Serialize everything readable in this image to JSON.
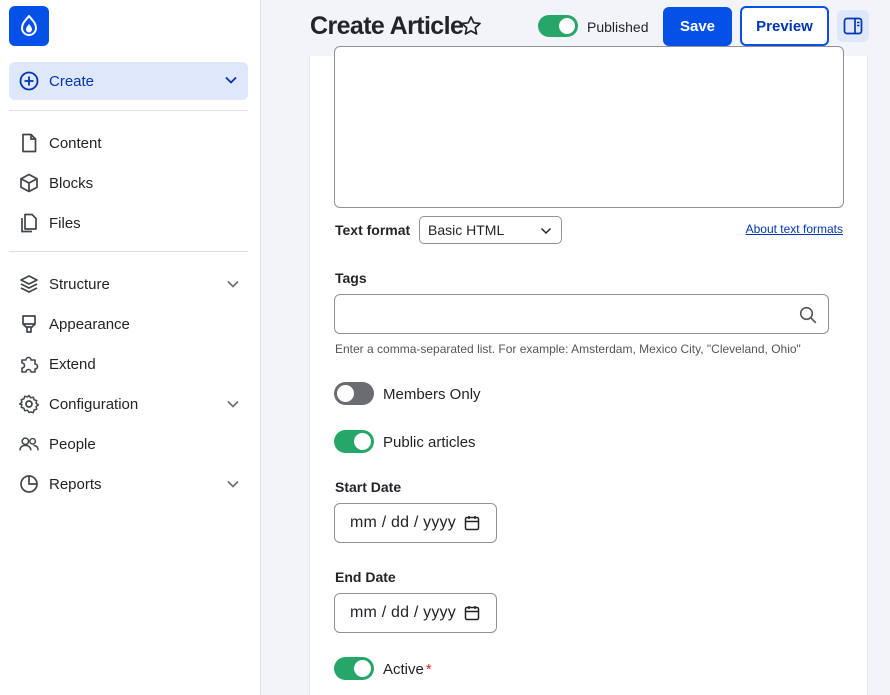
{
  "sidebar": {
    "create_label": "Create",
    "items": [
      {
        "label": "Content",
        "icon": "file-icon"
      },
      {
        "label": "Blocks",
        "icon": "cube-icon"
      },
      {
        "label": "Files",
        "icon": "files-icon"
      },
      {
        "label": "Structure",
        "icon": "layers-icon"
      },
      {
        "label": "Appearance",
        "icon": "brush-icon"
      },
      {
        "label": "Extend",
        "icon": "puzzle-icon"
      },
      {
        "label": "Configuration",
        "icon": "gear-icon"
      },
      {
        "label": "People",
        "icon": "people-icon"
      },
      {
        "label": "Reports",
        "icon": "pie-chart-icon"
      }
    ]
  },
  "header": {
    "title": "Create Article",
    "published_label": "Published",
    "save_label": "Save",
    "preview_label": "Preview"
  },
  "form": {
    "text_format_label": "Text format",
    "text_format_value": "Basic HTML",
    "about_link": "About text formats",
    "tags_label": "Tags",
    "tags_value": "",
    "tags_help": "Enter a comma-separated list. For example: Amsterdam, Mexico City, \"Cleveland, Ohio\"",
    "members_only_label": "Members Only",
    "public_articles_label": "Public articles",
    "start_date_label": "Start Date",
    "start_date_value": "mm / dd / yyyy",
    "end_date_label": "End Date",
    "end_date_value": "mm / dd / yyyy",
    "active_label": "Active",
    "required_mark": "*"
  },
  "colors": {
    "brand": "#0550e6",
    "toggle_on": "#26a769",
    "toggle_off": "#6b6c72",
    "link": "#0036b1"
  }
}
